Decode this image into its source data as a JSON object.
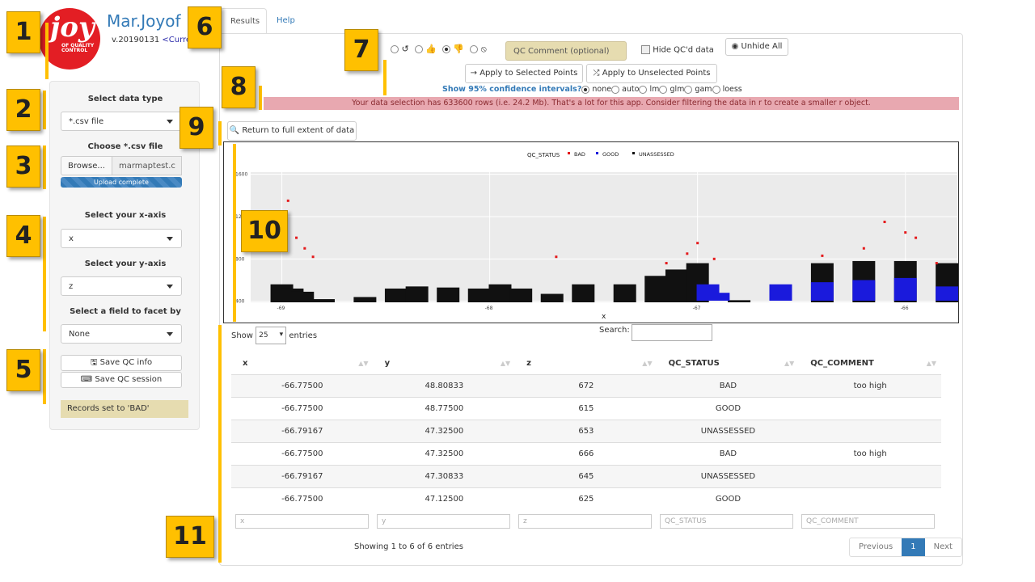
{
  "app": {
    "logo_big": "joy",
    "logo_small": "OF QUALITY CONTROL",
    "title": "Mar.Joyof",
    "version": "v.20190131",
    "version_link": "<Curren"
  },
  "sidebar": {
    "data_type_label": "Select data type",
    "data_type_value": "*.csv file",
    "file_label": "Choose *.csv file",
    "browse": "Browse...",
    "file_name": "marmaptest.c",
    "upload_status": "Upload complete",
    "x_label": "Select your x-axis",
    "x_value": "x",
    "y_label": "Select your y-axis",
    "y_value": "z",
    "facet_label": "Select a field to facet by",
    "facet_value": "None",
    "save_info": "Save QC info",
    "save_session": "Save QC session",
    "records_msg": "Records set to 'BAD'"
  },
  "tabs": [
    "Results",
    "Help"
  ],
  "toolbar": {
    "qc_comment": "QC Comment (optional)",
    "hide_qcd": "Hide QC'd data",
    "unhide_all": "Unhide All",
    "apply_selected": "Apply to Selected Points",
    "apply_unselected": "Apply to Unselected Points"
  },
  "confidence": {
    "question": "Show 95% confidence intervals?",
    "options": [
      "none",
      "auto",
      "lm",
      "glm",
      "gam",
      "loess"
    ],
    "selected": "none"
  },
  "alert": "Your data selection has 633600 rows (i.e. 24.2 Mb). That's a lot for this app. Consider filtering the data in r to create a smaller r object.",
  "return_btn": "Return to full extent of data",
  "annotations": [
    "1",
    "2",
    "3",
    "4",
    "5",
    "6",
    "7",
    "8",
    "9",
    "10",
    "11"
  ],
  "colors": {
    "bad": "#e41a1c",
    "good": "#1a1adc",
    "unassessed": "#111111",
    "accent": "#337ab7",
    "annot": "#ffc000"
  },
  "chart_data": {
    "type": "scatter",
    "legend_title": "QC_STATUS",
    "legend": [
      "BAD",
      "GOOD",
      "UNASSESSED"
    ],
    "xlabel": "x",
    "ylabel": "",
    "xticks": [
      -69,
      -68,
      -67,
      -66
    ],
    "yticks": [
      400,
      800,
      1200,
      1600
    ],
    "xlim": [
      -69.15,
      -65.75
    ],
    "ylim": [
      390,
      1620
    ],
    "legend_position": "top",
    "series": [
      {
        "name": "UNASSESSED",
        "values": [
          [
            -69.0,
            560
          ],
          [
            -68.95,
            520
          ],
          [
            -68.9,
            490
          ],
          [
            -68.8,
            420
          ],
          [
            -68.6,
            440
          ],
          [
            -68.45,
            520
          ],
          [
            -68.35,
            540
          ],
          [
            -68.2,
            530
          ],
          [
            -68.05,
            520
          ],
          [
            -67.95,
            560
          ],
          [
            -67.85,
            520
          ],
          [
            -67.7,
            470
          ],
          [
            -67.55,
            560
          ],
          [
            -67.35,
            560
          ],
          [
            -67.2,
            640
          ],
          [
            -67.1,
            700
          ],
          [
            -67.0,
            760
          ],
          [
            -66.8,
            410
          ],
          [
            -66.4,
            760
          ],
          [
            -66.2,
            780
          ],
          [
            -66.0,
            780
          ],
          [
            -65.8,
            760
          ]
        ]
      },
      {
        "name": "BAD",
        "values": [
          [
            -69.02,
            1100
          ],
          [
            -68.97,
            1350
          ],
          [
            -68.93,
            1000
          ],
          [
            -68.89,
            900
          ],
          [
            -68.85,
            820
          ],
          [
            -67.68,
            820
          ],
          [
            -67.15,
            760
          ],
          [
            -67.05,
            850
          ],
          [
            -67.0,
            950
          ],
          [
            -66.92,
            800
          ],
          [
            -66.4,
            830
          ],
          [
            -66.2,
            900
          ],
          [
            -66.1,
            1150
          ],
          [
            -66.0,
            1050
          ],
          [
            -65.95,
            1000
          ],
          [
            -65.85,
            760
          ]
        ]
      },
      {
        "name": "GOOD",
        "values": [
          [
            -66.95,
            560
          ],
          [
            -66.9,
            480
          ],
          [
            -66.6,
            560
          ],
          [
            -66.4,
            580
          ],
          [
            -66.2,
            600
          ],
          [
            -66.0,
            620
          ],
          [
            -65.8,
            540
          ]
        ]
      }
    ]
  },
  "table": {
    "show": "Show",
    "entries_value": "25",
    "entries": "entries",
    "search": "Search:",
    "columns": [
      "x",
      "y",
      "z",
      "QC_STATUS",
      "QC_COMMENT"
    ],
    "rows": [
      [
        "-66.77500",
        "48.80833",
        "672",
        "BAD",
        "too high"
      ],
      [
        "-66.77500",
        "48.77500",
        "615",
        "GOOD",
        ""
      ],
      [
        "-66.79167",
        "47.32500",
        "653",
        "UNASSESSED",
        ""
      ],
      [
        "-66.77500",
        "47.32500",
        "666",
        "BAD",
        "too high"
      ],
      [
        "-66.79167",
        "47.30833",
        "645",
        "UNASSESSED",
        ""
      ],
      [
        "-66.77500",
        "47.12500",
        "625",
        "GOOD",
        ""
      ]
    ],
    "filters": [
      "x",
      "y",
      "z",
      "QC_STATUS",
      "QC_COMMENT"
    ],
    "info": "Showing 1 to 6 of 6 entries",
    "prev": "Previous",
    "page": "1",
    "next": "Next"
  }
}
